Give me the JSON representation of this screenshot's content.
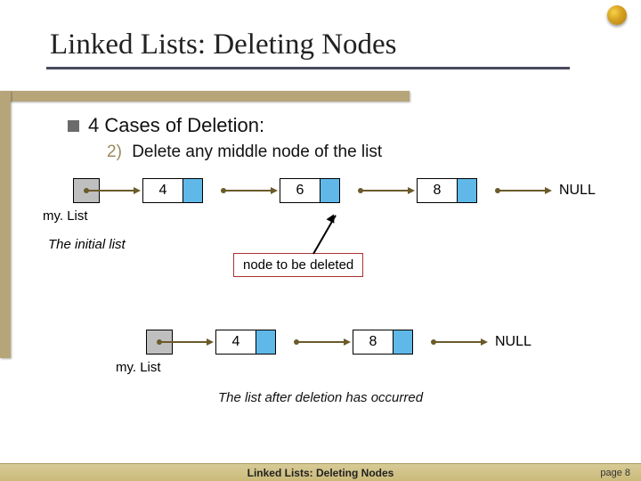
{
  "title": "Linked Lists:  Deleting Nodes",
  "bullet": "4 Cases of Deletion:",
  "sub_num": "2)",
  "sub_text": "Delete any middle node of the list",
  "before": {
    "head_label": "my. List",
    "nodes": [
      "4",
      "6",
      "8"
    ],
    "null_label": "NULL",
    "caption": "The initial list",
    "callout": "node to be deleted"
  },
  "after": {
    "head_label": "my. List",
    "nodes": [
      "4",
      "8"
    ],
    "null_label": "NULL",
    "caption": "The list after deletion has occurred"
  },
  "footer": {
    "center": "Linked Lists: Deleting Nodes",
    "page": "page 8"
  }
}
